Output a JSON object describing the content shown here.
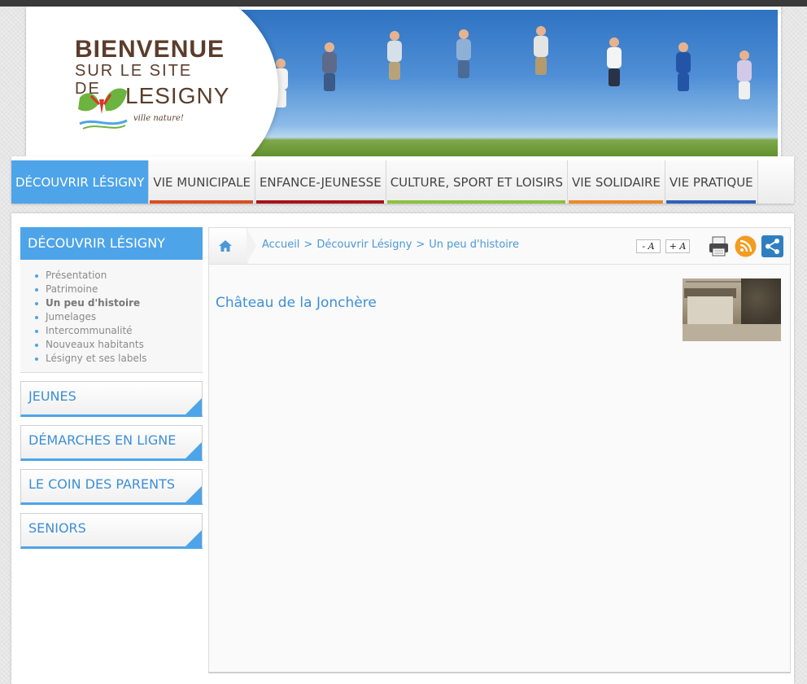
{
  "header": {
    "welcome_line1": "BIENVENUE",
    "welcome_line2": "SUR LE SITE DE",
    "logo_name": "LESIGNY",
    "logo_tagline": "ville nature!",
    "colors": {
      "brown": "#5b3d2b",
      "green": "#6db33f",
      "red": "#d9342b"
    }
  },
  "nav": {
    "items": [
      {
        "label": "DÉCOUVRIR LÉSIGNY",
        "color": "#4ea4e8",
        "active": true
      },
      {
        "label": "VIE MUNICIPALE",
        "color": "#d94f1e"
      },
      {
        "label": "ENFANCE-JEUNESSE",
        "color": "#a5141b"
      },
      {
        "label": "CULTURE, SPORT ET LOISIRS",
        "color": "#8cc13f"
      },
      {
        "label": "VIE SOLIDAIRE",
        "color": "#ec8a2a"
      },
      {
        "label": "VIE PRATIQUE",
        "color": "#2f62b4"
      }
    ]
  },
  "sidebar": {
    "title": "DÉCOUVRIR LÉSIGNY",
    "items": [
      {
        "label": "Présentation"
      },
      {
        "label": "Patrimoine"
      },
      {
        "label": "Un peu d'histoire",
        "current": true
      },
      {
        "label": "Jumelages"
      },
      {
        "label": "Intercommunalité"
      },
      {
        "label": "Nouveaux habitants"
      },
      {
        "label": "Lésigny et ses labels"
      }
    ],
    "boxes": [
      {
        "label": "JEUNES"
      },
      {
        "label": "DÉMARCHES EN LIGNE"
      },
      {
        "label": "LE COIN DES PARENTS"
      },
      {
        "label": "SENIORS"
      }
    ]
  },
  "breadcrumb": {
    "home_icon": "home-icon",
    "items": [
      "Accueil",
      "Découvrir Lésigny",
      "Un peu d'histoire"
    ],
    "separator": ">"
  },
  "tools": {
    "font_decrease": "- A",
    "font_increase": "+ A",
    "icons": [
      "print-icon",
      "rss-icon",
      "share-icon"
    ]
  },
  "article": {
    "title": "Château de la Jonchère"
  },
  "accent_color": "#4ea4e8"
}
